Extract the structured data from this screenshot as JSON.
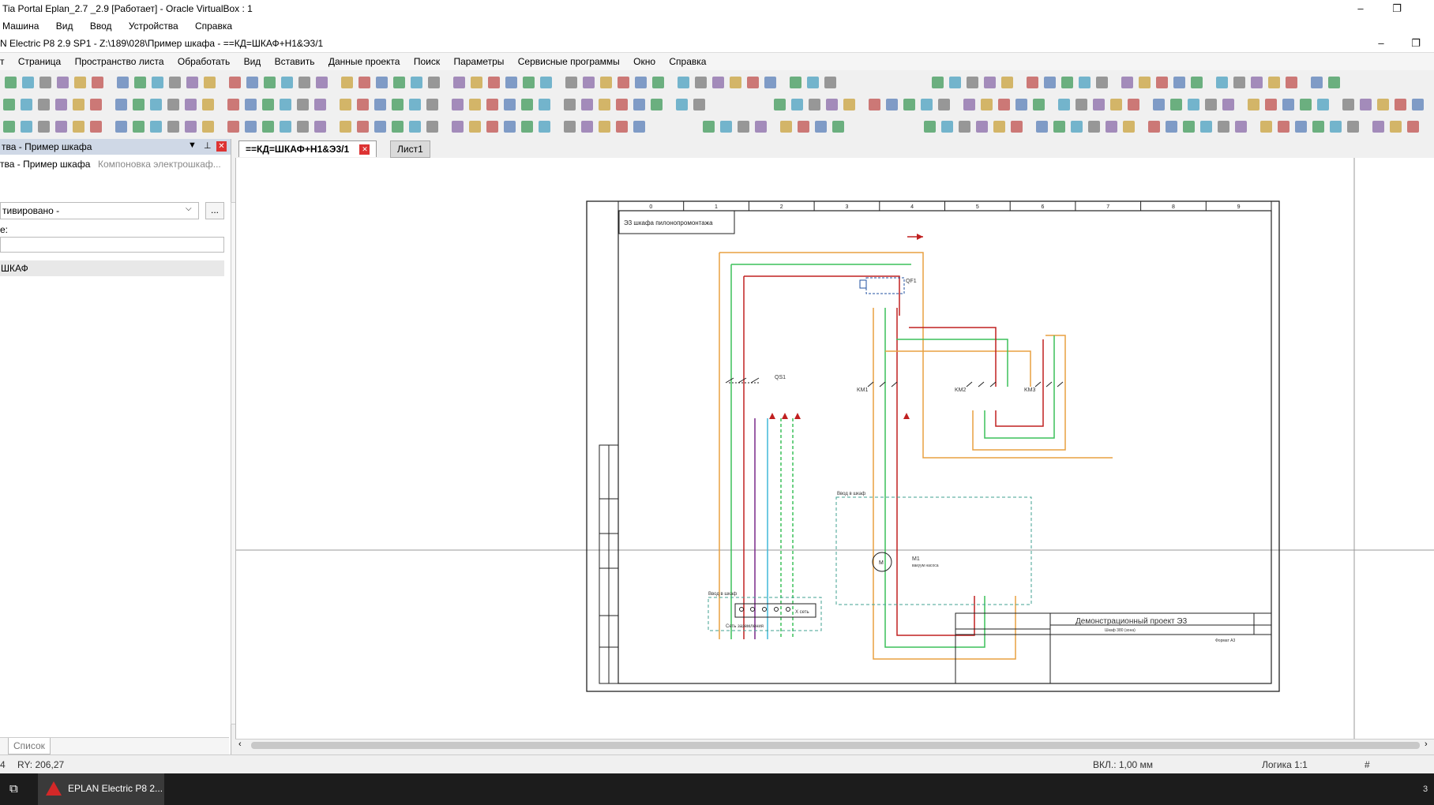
{
  "vbox": {
    "title": "Tia Portal  Eplan_2.7 _2.9 [Работает] - Oracle VirtualBox : 1",
    "menu": [
      "Машина",
      "Вид",
      "Ввод",
      "Устройства",
      "Справка"
    ]
  },
  "eplan": {
    "title": "N Electric P8 2.9 SP1 - Z:\\189\\028\\Пример шкафа - ==КД=ШКАФ+Н1&Э3/1",
    "menu": [
      "т",
      "Страница",
      "Пространство листа",
      "Обработать",
      "Вид",
      "Вставить",
      "Данные проекта",
      "Поиск",
      "Параметры",
      "Сервисные программы",
      "Окно",
      "Справка"
    ]
  },
  "left_panel": {
    "title": "тва - Пример шкафа",
    "tab1": "тва - Пример шкафа",
    "tab2": "Компоновка электрошкаф...",
    "filter_value": "тивировано -",
    "filter_btn": "...",
    "field_label": "е:",
    "tree_item": "ШКАФ",
    "bottom_tab": "Список"
  },
  "doc_tabs": {
    "active": "==КД=ШКАФ+Н1&Э3/1",
    "second": "Лист1"
  },
  "drawing": {
    "title_box": "Э3 шкафа пилонопромонтажа",
    "project_title": "Демонстрационный проект Э3",
    "subtitle": "Шкаф 380 (зона)",
    "format": "Формат А3",
    "column_numbers": [
      "0",
      "1",
      "2",
      "3",
      "4",
      "5",
      "6",
      "7",
      "8",
      "9"
    ],
    "labels": {
      "qf1": "QF1",
      "qs1": "QS1",
      "km1": "KM1",
      "km2": "KM2",
      "km3": "KM3",
      "m1": "M1",
      "m1_desc": "вакуум насоса",
      "box1": "Ввод в шкаф",
      "box2": "Ввод в шкаф",
      "net": "Сеть заземления",
      "xt": "X сеть"
    }
  },
  "status": {
    "left": "4",
    "ry": "RY: 206,27",
    "vkl": "ВКЛ.: 1,00 мм",
    "logic": "Логика 1:1",
    "hash": "#"
  },
  "taskbar": {
    "app": "EPLAN Electric P8 2...",
    "right": "3"
  },
  "colors": {
    "wire_orange": "#e8a040",
    "wire_green": "#3cc05a",
    "wire_red": "#c02020",
    "wire_purple": "#7a2a8a",
    "wire_cyan": "#40b8d8",
    "box_dash": "#40a090",
    "tab_close": "#d33"
  }
}
